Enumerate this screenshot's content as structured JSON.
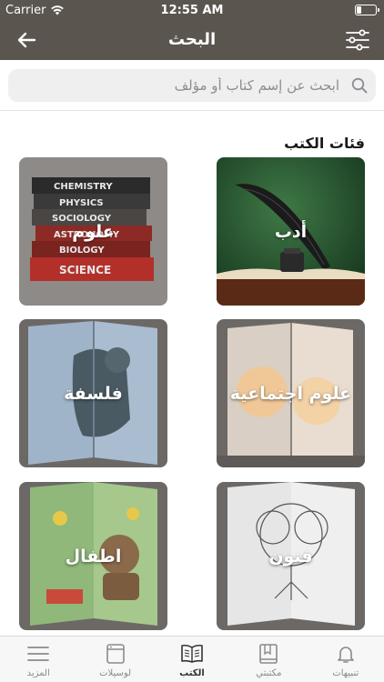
{
  "status": {
    "carrier": "Carrier",
    "time": "12:55 AM"
  },
  "header": {
    "title": "البحث",
    "back_icon": "arrow-left-icon",
    "filter_icon": "sliders-icon"
  },
  "search": {
    "placeholder": "ابحث عن إسم كتاب أو مؤلف",
    "value": ""
  },
  "categories": {
    "title": "فئات الكتب",
    "items": [
      {
        "label": "أدب"
      },
      {
        "label": "علوم",
        "book_spines": [
          "CHEMISTRY",
          "PHYSICS",
          "SOCIOLOGY",
          "ASTRONOMY",
          "BIOLOGY",
          "SCIENCE"
        ]
      },
      {
        "label": "علوم اجتماعية"
      },
      {
        "label": "فلسفة"
      },
      {
        "label": "فنون"
      },
      {
        "label": "اطفال"
      }
    ]
  },
  "tabbar": {
    "items": [
      {
        "label": "تنبيهات",
        "icon": "bell-icon"
      },
      {
        "label": "مكتبتي",
        "icon": "bookmark-book-icon"
      },
      {
        "label": "الكتب",
        "icon": "open-book-icon",
        "active": true
      },
      {
        "label": "لوسيلات",
        "icon": "tablet-icon"
      },
      {
        "label": "المزيد",
        "icon": "menu-icon"
      }
    ]
  },
  "colors": {
    "nav_bg": "#5b554f",
    "card_shadow": "#6e6a66"
  }
}
